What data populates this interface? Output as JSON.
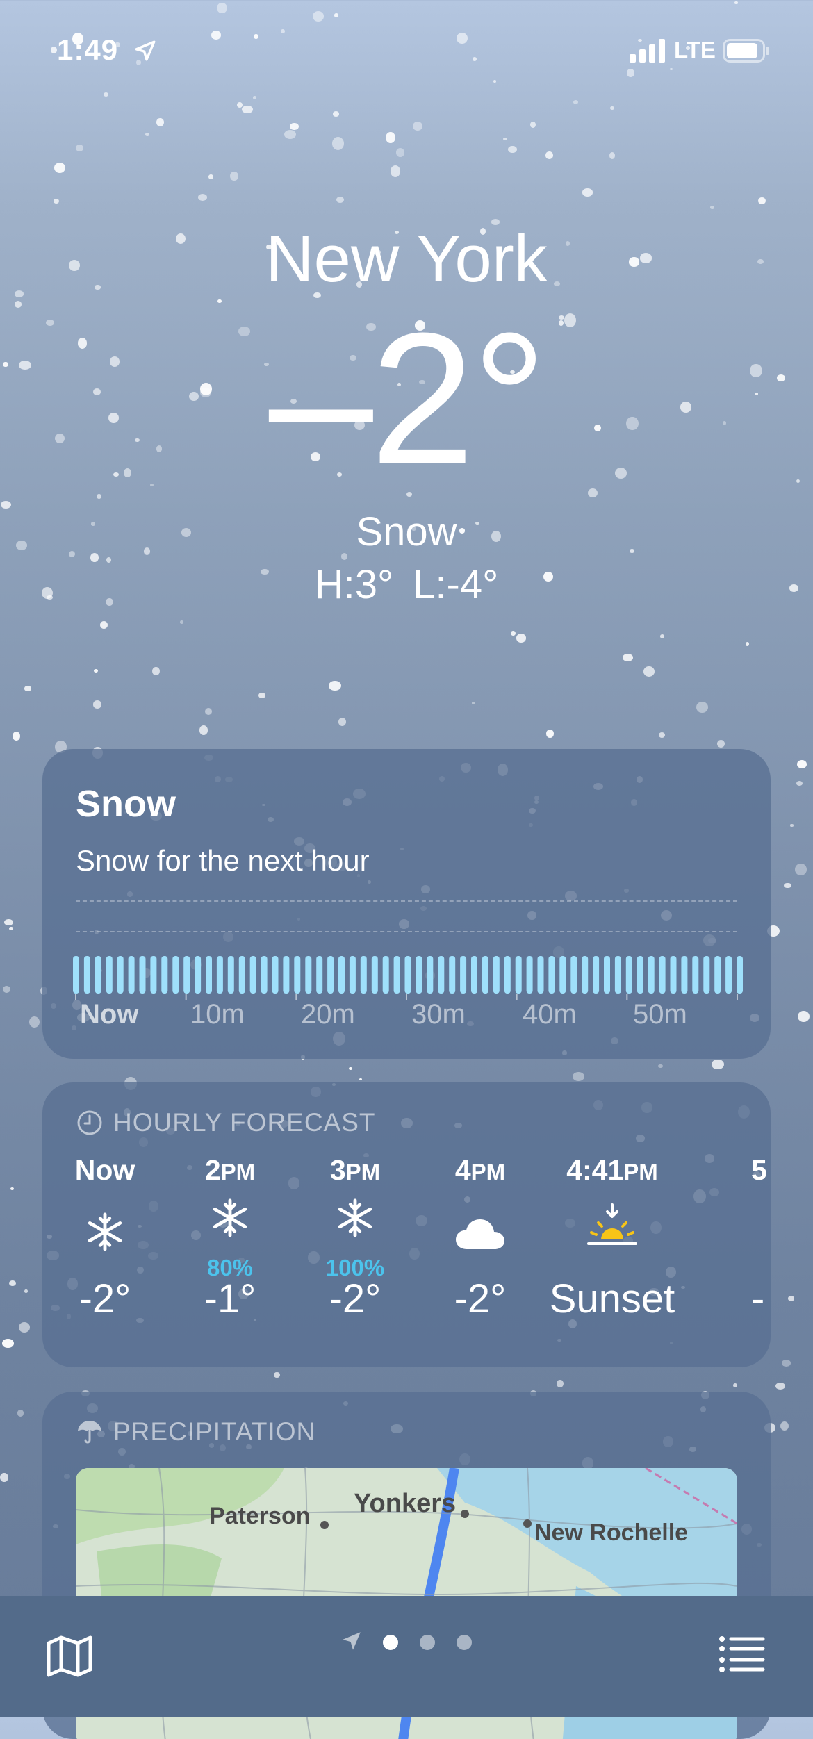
{
  "status_bar": {
    "time": "1:49",
    "network": "LTE"
  },
  "hero": {
    "city": "New York",
    "temperature": "–2°",
    "condition": "Snow",
    "high": "H:3°",
    "low": "L:-4°"
  },
  "nowcast": {
    "title": "Snow",
    "summary": "Snow for the next hour",
    "time_labels": [
      "Now",
      "10m",
      "20m",
      "30m",
      "40m",
      "50m"
    ]
  },
  "hourly": {
    "header": "HOURLY FORECAST",
    "items": [
      {
        "time": "Now",
        "suffix": "",
        "icon": "snowflake-icon",
        "precip": "",
        "temp": "-2°"
      },
      {
        "time": "2",
        "suffix": "PM",
        "icon": "snowflake-icon",
        "precip": "80%",
        "temp": "-1°"
      },
      {
        "time": "3",
        "suffix": "PM",
        "icon": "snowflake-icon",
        "precip": "100%",
        "temp": "-2°"
      },
      {
        "time": "4",
        "suffix": "PM",
        "icon": "cloud-icon",
        "precip": "",
        "temp": "-2°"
      },
      {
        "time": "4:41",
        "suffix": "PM",
        "icon": "sunset-icon",
        "precip": "",
        "temp": "Sunset"
      },
      {
        "time": "5",
        "suffix": "",
        "icon": "",
        "precip": "",
        "temp": "-"
      }
    ]
  },
  "precipitation": {
    "header": "PRECIPITATION",
    "map_labels": [
      "Paterson",
      "Yonkers",
      "New Rochelle"
    ]
  },
  "colors": {
    "precip_accent": "#4cc3ec",
    "sunset_sun": "#f7c417",
    "nowcast_bar": "#9fe0fb"
  }
}
